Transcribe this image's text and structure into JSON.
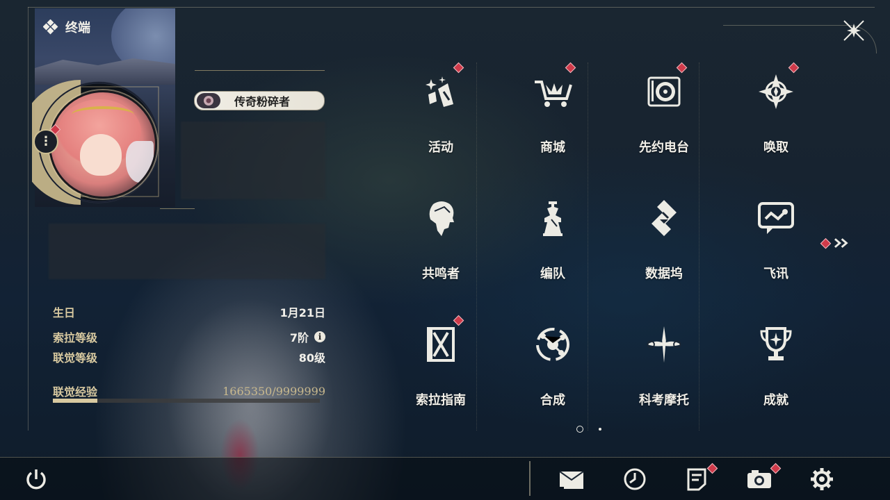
{
  "header": {
    "title": "终端"
  },
  "profile": {
    "title_badge": "传奇粉碎者"
  },
  "stats": [
    {
      "key": "生日",
      "value": "1月21日"
    },
    {
      "key": "索拉等级",
      "value": "7阶"
    },
    {
      "key": "联觉等级",
      "value": "80级"
    },
    {
      "key": "联觉经验",
      "value": "1665350/9999999"
    }
  ],
  "experience": {
    "current": 1665350,
    "max": 9999999,
    "fraction": 0.1665
  },
  "menu": [
    {
      "label": "活动",
      "icon": "activity-icon",
      "badge": true
    },
    {
      "label": "商城",
      "icon": "shop-cart-icon",
      "badge": true
    },
    {
      "label": "先约电台",
      "icon": "radio-icon",
      "badge": true
    },
    {
      "label": "唤取",
      "icon": "summon-compass-icon",
      "badge": true
    },
    {
      "label": "共鸣者",
      "icon": "resonator-head-icon",
      "badge": false
    },
    {
      "label": "编队",
      "icon": "chess-team-icon",
      "badge": false
    },
    {
      "label": "数据坞",
      "icon": "data-bank-icon",
      "badge": false
    },
    {
      "label": "飞讯",
      "icon": "chat-message-icon",
      "badge": false
    },
    {
      "label": "索拉指南",
      "icon": "guide-book-icon",
      "badge": true
    },
    {
      "label": "合成",
      "icon": "synthesis-icon",
      "badge": false
    },
    {
      "label": "科考摩托",
      "icon": "motorcycle-icon",
      "badge": false
    },
    {
      "label": "成就",
      "icon": "trophy-icon",
      "badge": false
    }
  ],
  "pagination": {
    "current": 1,
    "total": 2
  },
  "colors": {
    "accent_gold": "#d8c9a0",
    "badge_red": "#cf3a4a",
    "text_light": "#f1efe8"
  },
  "bottom_bar": {
    "icons": [
      "power-icon",
      "mail-icon",
      "clock-icon",
      "notes-icon",
      "camera-icon",
      "settings-gear-icon"
    ]
  }
}
